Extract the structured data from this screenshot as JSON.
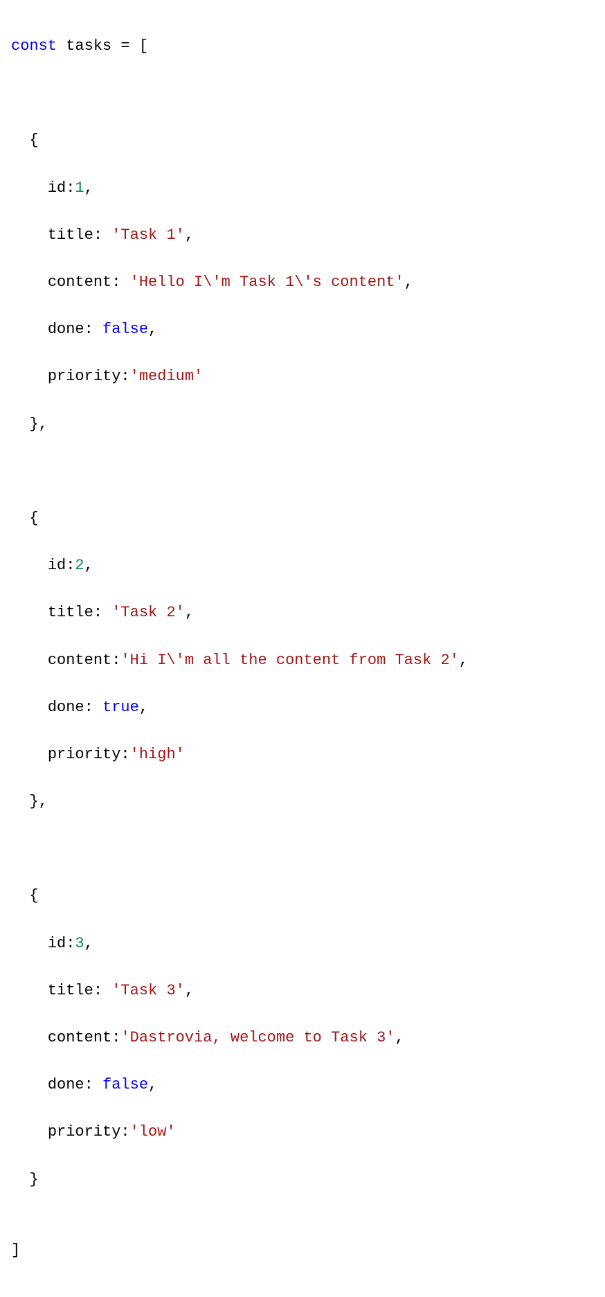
{
  "code": {
    "decl_keyword": "const",
    "var_name": "tasks",
    "equals": " = [",
    "open_brace": "{",
    "close_brace_comma": "},",
    "close_brace": "}",
    "close_bracket": "]",
    "items": [
      {
        "id_label": "id:",
        "id_value": "1",
        "title_label": "title: ",
        "title_value": "'Task 1'",
        "content_label": "content: ",
        "content_value": "'Hello I\\'m Task 1\\'s content'",
        "done_label": "done: ",
        "done_value": "false",
        "priority_label": "priority:",
        "priority_value": "'medium'"
      },
      {
        "id_label": "id:",
        "id_value": "2",
        "title_label": "title: ",
        "title_value": "'Task 2'",
        "content_label": "content:",
        "content_value": "'Hi I\\'m all the content from Task 2'",
        "done_label": "done: ",
        "done_value": "true",
        "priority_label": "priority:",
        "priority_value": "'high'"
      },
      {
        "id_label": "id:",
        "id_value": "3",
        "title_label": "title: ",
        "title_value": "'Task 3'",
        "content_label": "content:",
        "content_value": "'Dastrovia, welcome to Task 3'",
        "done_label": "done: ",
        "done_value": "false",
        "priority_label": "priority:",
        "priority_value": "'low'"
      }
    ]
  }
}
